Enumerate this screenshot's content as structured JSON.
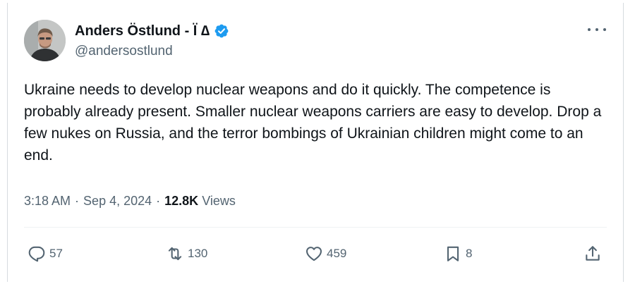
{
  "author": {
    "display_name": "Anders Östlund - Ï ∆",
    "handle": "@andersostlund",
    "verified": true,
    "verified_color": "#1d9bf0"
  },
  "tweet": {
    "text": "Ukraine needs to develop nuclear weapons and do it quickly. The competence is probably already present. Smaller nuclear weapons carriers are easy to develop. Drop a few nukes on Russia, and the terror bombings of Ukrainian children might come to an end.",
    "time": "3:18 AM",
    "separator": "·",
    "date": "Sep 4, 2024",
    "views_count": "12.8K",
    "views_label": "Views"
  },
  "actions": {
    "replies": "57",
    "reposts": "130",
    "likes": "459",
    "bookmarks": "8"
  },
  "icons": {
    "more": "more-horizontal-icon",
    "verified": "verified-badge-icon",
    "reply": "reply-icon",
    "repost": "repost-icon",
    "like": "heart-icon",
    "bookmark": "bookmark-icon",
    "share": "share-icon"
  }
}
